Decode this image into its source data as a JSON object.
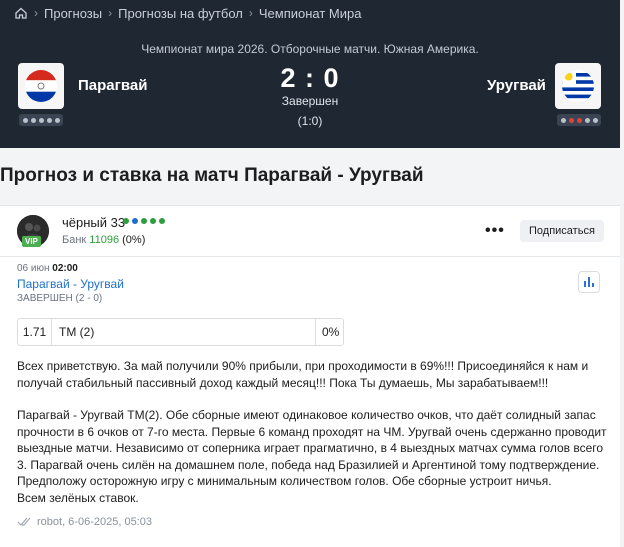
{
  "breadcrumbs": [
    "Прогнозы",
    "Прогнозы на футбол",
    "Чемпионат Мира"
  ],
  "match": {
    "tournament": "Чемпионат мира 2026. Отборочные матчи. Южная Америка.",
    "home_team": "Парагвай",
    "away_team": "Уругвай",
    "score": "2 : 0",
    "status": "Завершен",
    "half_time": "(1:0)"
  },
  "page_title": "Прогноз и ставка на матч Парагвай - Уругвай",
  "post": {
    "author": "чёрный 33",
    "badge": "VIP",
    "bank_label": "Банк",
    "bank_value": "11096",
    "bank_percent": "(0%)",
    "subscribe_label": "Подписаться",
    "date_day": "06 июн",
    "date_time": "02:00",
    "match_link": "Парагвай - Уругвай",
    "match_status": "ЗАВЕРШЕН (2 - 0)",
    "bet": {
      "odds": "1.71",
      "type": "ТМ (2)",
      "percent": "0%"
    },
    "paragraph1": "Всех приветствую. За май получили 90% прибыли, при проходимости в 69%!!! Присоединяйся к нам и получай стабильный пассивный доход каждый месяц!!! Пока Ты думаешь, Мы зарабатываем!!!",
    "paragraph2": "Парагвай - Уругвай ТМ(2). Обе сборные имеют одинаковое количество очков, что даёт солидный запас прочности в 6 очков от 7-го места. Первые 6 команд проходят на ЧМ. Уругвай очень сдержанно проводит выездные матчи. Независимо от соперника играет прагматично, в 4 выездных матчах сумма голов всего 3. Парагвай очень силён на домашнем поле, победа над Бразилией и Аргентиной тому подтверждение. Предположу осторожную игру с минимальным количеством голов. Обе сборные устроит ничья.",
    "paragraph3": "Всем зелёных ставок.",
    "footer": "robot, 6-06-2025, 05:03"
  },
  "colors": {
    "header_bg": "#1f2733",
    "link": "#1e6fc7",
    "bank": "#2e9d3e",
    "vip": "#4caf50"
  }
}
